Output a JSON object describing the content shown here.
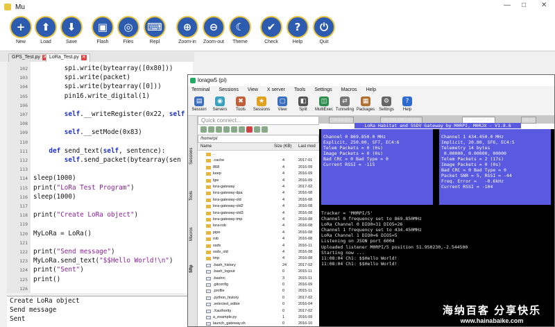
{
  "mu": {
    "title": "Mu",
    "window_controls": [
      "—",
      "□",
      "✕"
    ],
    "toolbar": [
      {
        "label": "New",
        "icon": "plus-icon",
        "glyph": "+"
      },
      {
        "label": "Load",
        "icon": "upload-icon",
        "glyph": "⬆"
      },
      {
        "label": "Save",
        "icon": "download-icon",
        "glyph": "⬇"
      },
      {
        "label": "Flash",
        "icon": "microbit-icon",
        "glyph": "▣"
      },
      {
        "label": "Files",
        "icon": "files-icon",
        "glyph": "◎"
      },
      {
        "label": "Repl",
        "icon": "keyboard-icon",
        "glyph": "⌨"
      },
      {
        "label": "Zoom-in",
        "icon": "zoom-in-icon",
        "glyph": "⊕"
      },
      {
        "label": "Zoom-out",
        "icon": "zoom-out-icon",
        "glyph": "⊖"
      },
      {
        "label": "Theme",
        "icon": "moon-icon",
        "glyph": "☾"
      },
      {
        "label": "Check",
        "icon": "thumbs-up-icon",
        "glyph": "✔"
      },
      {
        "label": "Help",
        "icon": "question-icon",
        "glyph": "?"
      },
      {
        "label": "Quit",
        "icon": "power-icon",
        "glyph": "⏻"
      }
    ],
    "tabs": [
      {
        "label": "GPS_Test.py",
        "close": "✕"
      },
      {
        "label": "LoRa_Test.py",
        "close": "✕"
      }
    ],
    "code": [
      {
        "ln": "102",
        "text": "        spi.write(bytearray([0x80]))"
      },
      {
        "ln": "103",
        "text": "        spi.write(packet)"
      },
      {
        "ln": "104",
        "text": "        spi.write(bytearray([0]))"
      },
      {
        "ln": "105",
        "text": "        pin16.write_digital(1)"
      },
      {
        "ln": "106",
        "text": ""
      },
      {
        "ln": "107",
        "text": "        self.__writeRegister(0x22, self"
      },
      {
        "ln": "108",
        "text": ""
      },
      {
        "ln": "109",
        "text": "        self.__setMode(0x83)"
      },
      {
        "ln": "110",
        "text": ""
      },
      {
        "ln": "111",
        "text": "    def send_text(self, sentence):"
      },
      {
        "ln": "112",
        "text": "        self.send_packet(bytearray(sen"
      },
      {
        "ln": "113",
        "text": ""
      },
      {
        "ln": "114",
        "text": "sleep(1000)"
      },
      {
        "ln": "115",
        "text": "print(\"LoRa Test Program\")"
      },
      {
        "ln": "116",
        "text": "sleep(1000)"
      },
      {
        "ln": "117",
        "text": ""
      },
      {
        "ln": "118",
        "text": "print(\"Create LoRa object\")"
      },
      {
        "ln": "119",
        "text": ""
      },
      {
        "ln": "120",
        "text": "MyLoRa = LoRa()"
      },
      {
        "ln": "121",
        "text": ""
      },
      {
        "ln": "122",
        "text": "print(\"Send message\")"
      },
      {
        "ln": "123",
        "text": "MyLoRa.send_text(\"$$Hello World!\\n\")"
      },
      {
        "ln": "124",
        "text": "print(\"Sent\")"
      },
      {
        "ln": "125",
        "text": "print()"
      },
      {
        "ln": "126",
        "text": ""
      }
    ],
    "repl_output": [
      "Create LoRa object",
      "Send message",
      "Sent"
    ]
  },
  "mobaxterm": {
    "title": "loragw5 (pi)",
    "menu": [
      "Terminal",
      "Sessions",
      "View",
      "X server",
      "Tools",
      "Settings",
      "Macros",
      "Help"
    ],
    "tools": [
      {
        "label": "Session",
        "icon": "session-icon",
        "color": "#3a6fc0",
        "glyph": "▤"
      },
      {
        "label": "Servers",
        "icon": "servers-icon",
        "color": "#3aa0c0",
        "glyph": "◉"
      },
      {
        "label": "Tools",
        "icon": "tools-icon",
        "color": "#c0603a",
        "glyph": "✖"
      },
      {
        "label": "Sessions",
        "icon": "star-icon",
        "color": "#e0a020",
        "glyph": "★"
      },
      {
        "label": "View",
        "icon": "view-icon",
        "color": "#3a6fc0",
        "glyph": "▢"
      },
      {
        "label": "Split",
        "icon": "split-icon",
        "color": "#555555",
        "glyph": "◧"
      },
      {
        "label": "MultiExec",
        "icon": "multiexec-icon",
        "color": "#2f8f4f",
        "glyph": "◫"
      },
      {
        "label": "Tunneling",
        "icon": "tunneling-icon",
        "color": "#777777",
        "glyph": "⇄"
      },
      {
        "label": "Packages",
        "icon": "packages-icon",
        "color": "#b07030",
        "glyph": "▦"
      },
      {
        "label": "Settings",
        "icon": "settings-icon",
        "color": "#666666",
        "glyph": "⚙"
      },
      {
        "label": "Help",
        "icon": "help-icon",
        "color": "#2d6ad0",
        "glyph": "?"
      }
    ],
    "side_tabs": [
      "Sessions",
      "Tools",
      "Macros",
      "Sftp"
    ],
    "quick_connect": "Quick connect...",
    "path": "/home/pi/",
    "file_columns": [
      "Name",
      "Size (KB)",
      "Last mod"
    ],
    "files": [
      {
        "name": "..",
        "size": "",
        "date": "",
        "type": "folder"
      },
      {
        "name": ".cache",
        "size": "4",
        "date": "2017-01",
        "type": "folder"
      },
      {
        "name": "868",
        "size": "4",
        "date": "2016-09",
        "type": "folder"
      },
      {
        "name": "keep",
        "size": "4",
        "date": "2016-09",
        "type": "folder"
      },
      {
        "name": "lgw",
        "size": "4",
        "date": "2016-09",
        "type": "folder"
      },
      {
        "name": "lora-gateway",
        "size": "4",
        "date": "2017-02",
        "type": "folder"
      },
      {
        "name": "lora-gateway-dpa",
        "size": "4",
        "date": "2016-08",
        "type": "folder"
      },
      {
        "name": "lora-gateway-old",
        "size": "4",
        "date": "2016-08",
        "type": "folder"
      },
      {
        "name": "lora-gateway-old2",
        "size": "4",
        "date": "2016-08",
        "type": "folder"
      },
      {
        "name": "lora-gateway-old3",
        "size": "4",
        "date": "2016-08",
        "type": "folder"
      },
      {
        "name": "lora-gateway-tmp",
        "size": "4",
        "date": "2016-08",
        "type": "folder"
      },
      {
        "name": "lora-rob",
        "size": "4",
        "date": "2016-08",
        "type": "folder"
      },
      {
        "name": "pipe",
        "size": "4",
        "date": "2016-08",
        "type": "folder"
      },
      {
        "name": "rob",
        "size": "4",
        "date": "2016-08",
        "type": "folder"
      },
      {
        "name": "ssdv",
        "size": "4",
        "date": "2016-11",
        "type": "folder"
      },
      {
        "name": "ssdv_old",
        "size": "4",
        "date": "2016-08",
        "type": "folder"
      },
      {
        "name": "tmp",
        "size": "4",
        "date": "2016-08",
        "type": "folder"
      },
      {
        "name": ".bash_history",
        "size": "24",
        "date": "2017-02",
        "type": "file"
      },
      {
        "name": ".bash_logout",
        "size": "0",
        "date": "2015-11",
        "type": "file"
      },
      {
        "name": ".bashrc",
        "size": "3",
        "date": "2015-11",
        "type": "file"
      },
      {
        "name": ".gitconfig",
        "size": "0",
        "date": "2016-09",
        "type": "file"
      },
      {
        "name": ".profile",
        "size": "0",
        "date": "2015-11",
        "type": "file"
      },
      {
        "name": ".python_history",
        "size": "0",
        "date": "2017-02",
        "type": "file"
      },
      {
        "name": ".selected_editor",
        "size": "0",
        "date": "2016-04",
        "type": "file"
      },
      {
        "name": ".Xauthority",
        "size": "0",
        "date": "2017-02",
        "type": "file"
      },
      {
        "name": "a_example.py",
        "size": "1",
        "date": "2016-09",
        "type": "file"
      },
      {
        "name": "launch_gateway.sh",
        "size": "0",
        "date": "2016-10",
        "type": "file"
      },
      {
        "name": "monitor_gateway.py",
        "size": "1",
        "date": "2016-08",
        "type": "file"
      }
    ],
    "terminal_tabs": [
      "24. pip (pi)",
      "26. 192.168.1.20 (pi)",
      "27. loragw5 (pi)",
      "23. p"
    ],
    "banner": "LoRa Habitat and SSDV Gateway by M0RPI, M0RJX - V1.8.8",
    "panel_left": [
      "Channel 0 869.850.0 MHz",
      "Explicit, 250.00, SF7, EC4:6",
      "",
      "",
      "",
      "",
      "",
      "Telem Packets = 0 (0s)",
      "Image Packets = 0 (0s)",
      "Bad CRC = 0 Bad Type = 0",
      "",
      "",
      "Current RSSI = -115"
    ],
    "panel_right": [
      "Channel 1 434.450.0 MHz",
      "Implicit, 20.80, SF6, EC4:5",
      "Telemetry 14 bytes",
      " 0.00000, 0.00000, 00000",
      "",
      "",
      "",
      "Telem Packets = 2 (17s)",
      "Image Packets = 0 (0s)",
      "Bad CRC = 0 Bad Type = 0",
      "Packet SNR = 5, RSSI = -44",
      "Freq. Error =   -0.6kHz",
      "Current RSSI = -104"
    ],
    "terminal_lines": [
      "Tracker = 'M0RPI/5'",
      "Channel 0 frequency set to 869.850MHz",
      "LoRa Channel 0 DIO0=31 DIO5=26",
      "Channel 1 frequency set to 434.450MHz",
      "LoRa Channel 1 DIO0=6 DIO5=5",
      "Listening on JSON port 6004",
      "Uploaded listener M0RPI/5 position 51.950230,-2.544500",
      "Starting now ...",
      "11:08:04 Ch1: $$Hello World!",
      "11:08:04 Ch1: $$Hello World!"
    ]
  },
  "watermark": {
    "line1": "海纳百客 分享快乐",
    "line2": "www.hainabaike.com"
  }
}
